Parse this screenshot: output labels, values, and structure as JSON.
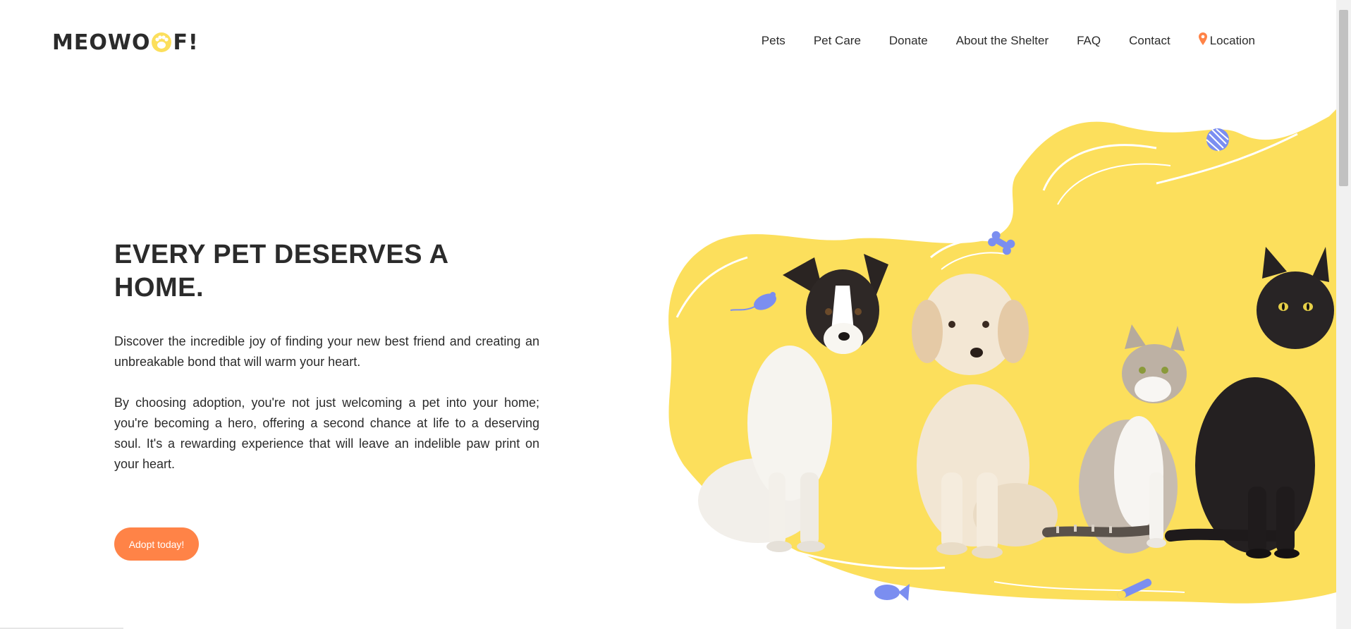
{
  "brand": {
    "logo_prefix": "MEOWO",
    "logo_suffix": "F!",
    "colors": {
      "accent": "#ff8347",
      "highlight": "#fcdf5c",
      "toy": "#7b8ef0",
      "text": "#2b2b2b"
    }
  },
  "nav": {
    "items": [
      {
        "label": "Pets"
      },
      {
        "label": "Pet Care"
      },
      {
        "label": "Donate"
      },
      {
        "label": "About the Shelter"
      },
      {
        "label": "FAQ"
      },
      {
        "label": "Contact"
      }
    ],
    "location_label": "Location",
    "location_icon": "map-pin-icon"
  },
  "hero": {
    "title": "EVERY PET DESERVES A HOME.",
    "paragraph_1": "Discover the incredible joy of finding your new best friend and creating an unbreakable bond that will warm your heart.",
    "paragraph_2": "By choosing adoption, you're not just welcoming a pet into your home; you're becoming a hero, offering a second chance at life to a deserving soul. It's a rewarding experience that will leave an indelible paw print on your heart.",
    "cta_label": "Adopt today!"
  },
  "illustration": {
    "animals": [
      "black-and-white-dog",
      "cream-puppy",
      "tabby-white-cat",
      "black-cat"
    ],
    "toys": [
      "yarn-ball-icon",
      "bone-icon",
      "toy-mouse-icon",
      "fish-icon",
      "toy-stick-icon"
    ]
  }
}
